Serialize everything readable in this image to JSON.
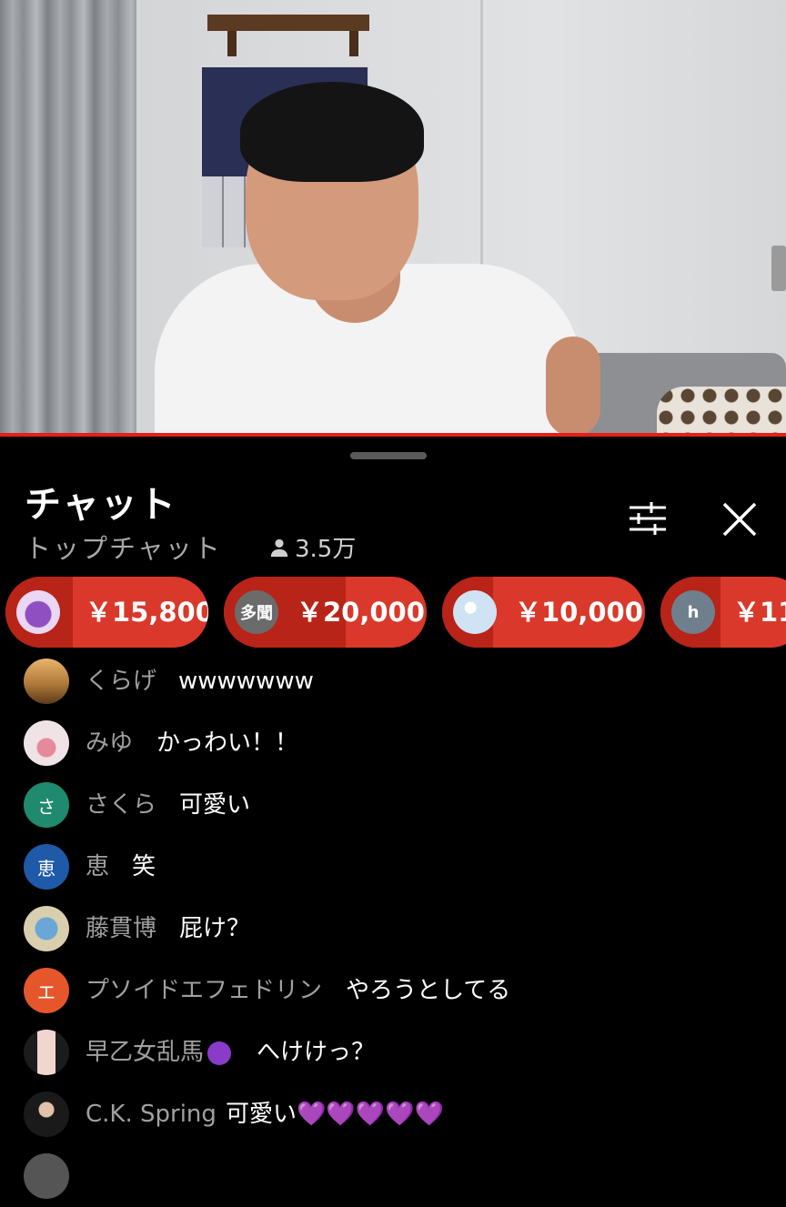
{
  "colors": {
    "accent": "#e4201b",
    "superchat_bg": "#d9382b",
    "superchat_dark": "#b82418",
    "text_primary": "#ffffff",
    "text_secondary": "#a0a0a0",
    "panel_bg": "#000000"
  },
  "video": {
    "description_icon": "live-video-frame"
  },
  "chat": {
    "title": "チャット",
    "mode": "トップチャット",
    "viewer_count": "3.5万",
    "filter_icon": "sliders-icon",
    "close_icon": "close-icon"
  },
  "superchats": [
    {
      "avatar_text": "",
      "amount": "￥15,800",
      "avatar_color": "#b57ad6"
    },
    {
      "avatar_text": "多聞",
      "amount": "￥20,000",
      "avatar_color": "#6b6b6b"
    },
    {
      "avatar_text": "",
      "amount": "￥10,000",
      "avatar_color": "#cfe3f4"
    },
    {
      "avatar_text": "h",
      "amount": "￥11",
      "avatar_color": "#6f7f8d"
    }
  ],
  "messages": [
    {
      "author": "くらげ",
      "text": "wwwwwww",
      "avatar_text": "",
      "avatar_color": "#b07a3a"
    },
    {
      "author": "みゆ",
      "text": "かっわい！！",
      "avatar_text": "",
      "avatar_color": "#efe3e6"
    },
    {
      "author": "さくら",
      "text": "可愛い",
      "avatar_text": "さ",
      "avatar_color": "#1f8a6e"
    },
    {
      "author": "恵",
      "text": "笑",
      "avatar_text": "恵",
      "avatar_color": "#1e5aa8"
    },
    {
      "author": "藤貫博",
      "text": "屁け？",
      "avatar_text": "",
      "avatar_color": "#d9cfae"
    },
    {
      "author": "プソイドエフェドリン",
      "text": "やろうとしてる",
      "avatar_text": "エ",
      "avatar_color": "#e5572a"
    },
    {
      "author": "早乙女乱馬",
      "text": "へけけっ？",
      "avatar_text": "",
      "avatar_color": "#e9dce0"
    },
    {
      "author": "C.K. Spring",
      "text": "可愛い💜💜💜💜💜",
      "avatar_text": "",
      "avatar_color": "#2a2a2a"
    }
  ]
}
